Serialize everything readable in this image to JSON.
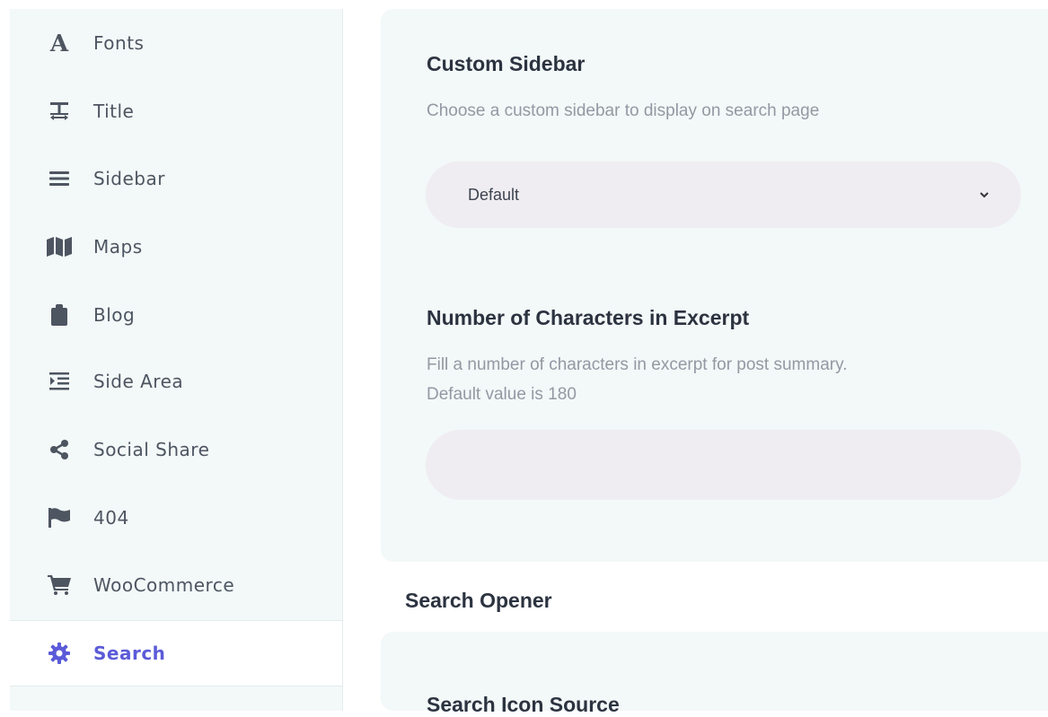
{
  "sidebar": {
    "items": [
      {
        "label": "Fonts",
        "icon": "font-icon"
      },
      {
        "label": "Title",
        "icon": "text-height-icon"
      },
      {
        "label": "Sidebar",
        "icon": "bars-icon"
      },
      {
        "label": "Maps",
        "icon": "map-icon"
      },
      {
        "label": "Blog",
        "icon": "clipboard-icon"
      },
      {
        "label": "Side Area",
        "icon": "indent-icon"
      },
      {
        "label": "Social Share",
        "icon": "share-icon"
      },
      {
        "label": "404",
        "icon": "flag-icon"
      },
      {
        "label": "WooCommerce",
        "icon": "cart-icon"
      },
      {
        "label": "Search",
        "icon": "gear-icon",
        "active": true
      }
    ]
  },
  "main": {
    "custom_sidebar": {
      "title": "Custom Sidebar",
      "description": "Choose a custom sidebar to display on search page",
      "selected": "Default"
    },
    "excerpt": {
      "title": "Number of Characters in Excerpt",
      "description_line1": "Fill a number of characters in excerpt for post summary.",
      "description_line2": "Default value is 180",
      "value": ""
    },
    "search_opener": {
      "heading": "Search Opener",
      "first_field_title": "Search Icon Source"
    }
  },
  "colors": {
    "accent": "#5b5bd9",
    "sidebar_bg": "#f3f8f8",
    "input_bg": "#efedf1",
    "icon": "#4d5561"
  }
}
